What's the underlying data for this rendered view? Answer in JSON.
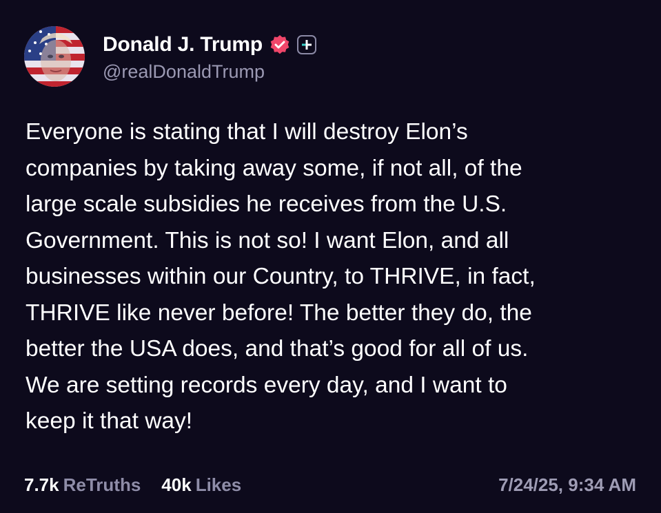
{
  "author": {
    "display_name": "Donald J. Trump",
    "handle": "@realDonaldTrump",
    "verified_icon": "verified-badge-icon",
    "plus_icon": "plus-icon"
  },
  "post": {
    "text": "Everyone is stating that I will destroy Elon’s\ncompanies by taking away some, if not all, of the\nlarge scale subsidies he receives from the U.S.\nGovernment. This is not so! I want Elon, and all\nbusinesses within our Country, to THRIVE, in fact,\nTHRIVE like never before! The better they do, the\nbetter the USA does, and that’s good for all of us.\nWe are setting records every day, and I want to\nkeep it that way!"
  },
  "stats": {
    "retruths_count": "7.7k",
    "retruths_label": "ReTruths",
    "likes_count": "40k",
    "likes_label": "Likes"
  },
  "timestamp": "7/24/25, 9:34 AM",
  "colors": {
    "background": "#0d0a1c",
    "verified": "#f0466a",
    "plus": "#3ad0c8",
    "secondary_text": "#9b99b3"
  }
}
